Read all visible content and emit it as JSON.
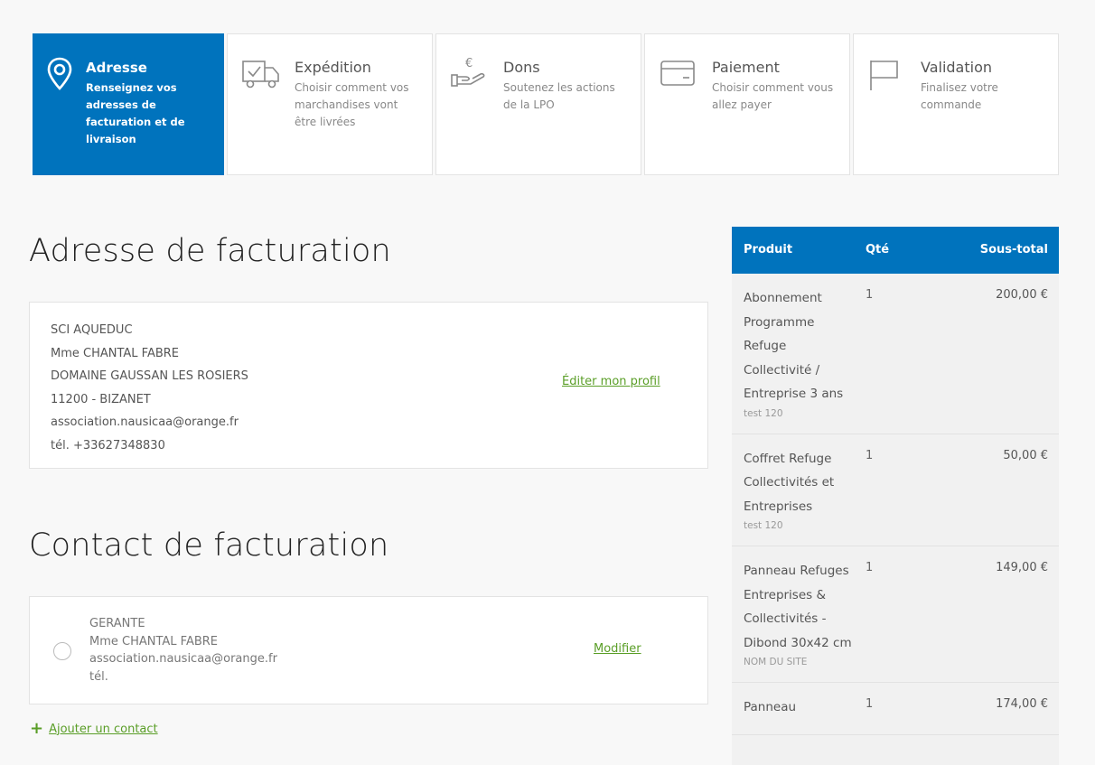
{
  "steps": [
    {
      "title": "Adresse",
      "desc": "Renseignez vos adresses de facturation et de livraison",
      "icon": "location-pin-icon",
      "active": true
    },
    {
      "title": "Expédition",
      "desc": "Choisir comment vos marchandises vont être livrées",
      "icon": "truck-icon",
      "active": false
    },
    {
      "title": "Dons",
      "desc": "Soutenez les actions de la LPO",
      "icon": "donation-hand-euro-icon",
      "active": false
    },
    {
      "title": "Paiement",
      "desc": "Choisir comment vous allez payer",
      "icon": "credit-card-icon",
      "active": false
    },
    {
      "title": "Validation",
      "desc": "Finalisez votre commande",
      "icon": "flag-icon",
      "active": false
    }
  ],
  "billing": {
    "title": "Adresse de facturation",
    "lines": [
      "SCI AQUEDUC",
      "Mme CHANTAL FABRE",
      "DOMAINE GAUSSAN LES ROSIERS",
      "11200 - BIZANET",
      "association.nausicaa@orange.fr",
      "tél. +33627348830"
    ],
    "edit_label": "Éditer mon profil"
  },
  "contact": {
    "title": "Contact de facturation",
    "lines": [
      "GERANTE",
      "Mme CHANTAL FABRE",
      "association.nausicaa@orange.fr",
      "tél."
    ],
    "modify_label": "Modifier",
    "add_label": "Ajouter un contact"
  },
  "summary": {
    "headers": {
      "product": "Produit",
      "qty": "Qté",
      "subtotal": "Sous-total"
    },
    "rows": [
      {
        "name": "Abonnement Programme Refuge Collectivité / Entreprise 3 ans",
        "meta": "test 120",
        "qty": "1",
        "price": "200,00 €"
      },
      {
        "name": "Coffret Refuge Collectivités et Entreprises",
        "meta": "test 120",
        "qty": "1",
        "price": "50,00 €"
      },
      {
        "name": "Panneau Refuges Entreprises & Collectivités - Dibond 30x42 cm",
        "meta": "NOM DU SITE",
        "qty": "1",
        "price": "149,00 €"
      },
      {
        "name": "Panneau",
        "meta": "",
        "qty": "1",
        "price": "174,00 €"
      }
    ]
  },
  "colors": {
    "primary": "#0073bd",
    "link": "#5a9e27"
  }
}
